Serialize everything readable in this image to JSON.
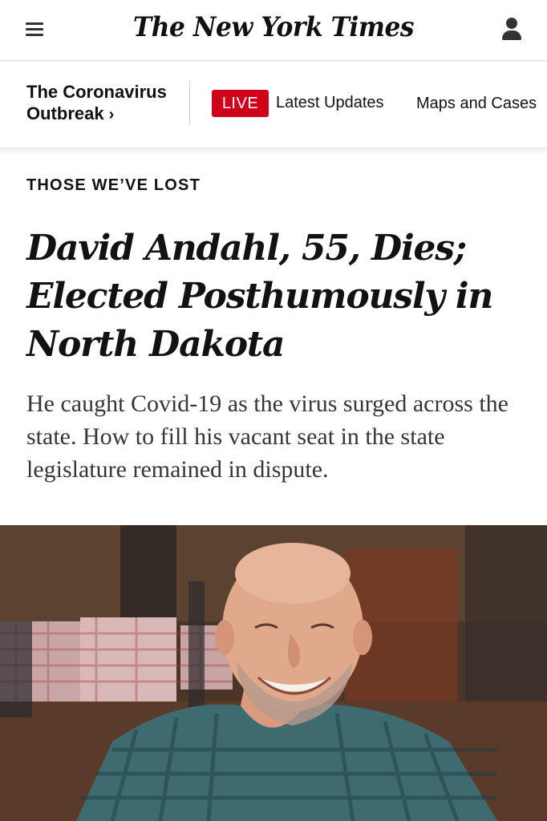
{
  "header": {
    "logo_text": "The New York Times",
    "menu_icon": "hamburger-menu-icon",
    "account_icon": "user-account-icon"
  },
  "section_bar": {
    "section_title": "The Coronavirus Outbreak",
    "section_chevron": "›",
    "live_label": "LIVE",
    "live_color": "#d0021b",
    "latest_updates_label": "Latest Updates",
    "maps_label": "Maps and Cases"
  },
  "article": {
    "kicker": "THOSE WE’VE LOST",
    "headline": "David Andahl, 55, Dies; Elected Posthumously in North Dakota",
    "summary": "He caught Covid-19 as the virus surged across the state. How to fill his vacant seat in the state legislature remained in dispute."
  }
}
